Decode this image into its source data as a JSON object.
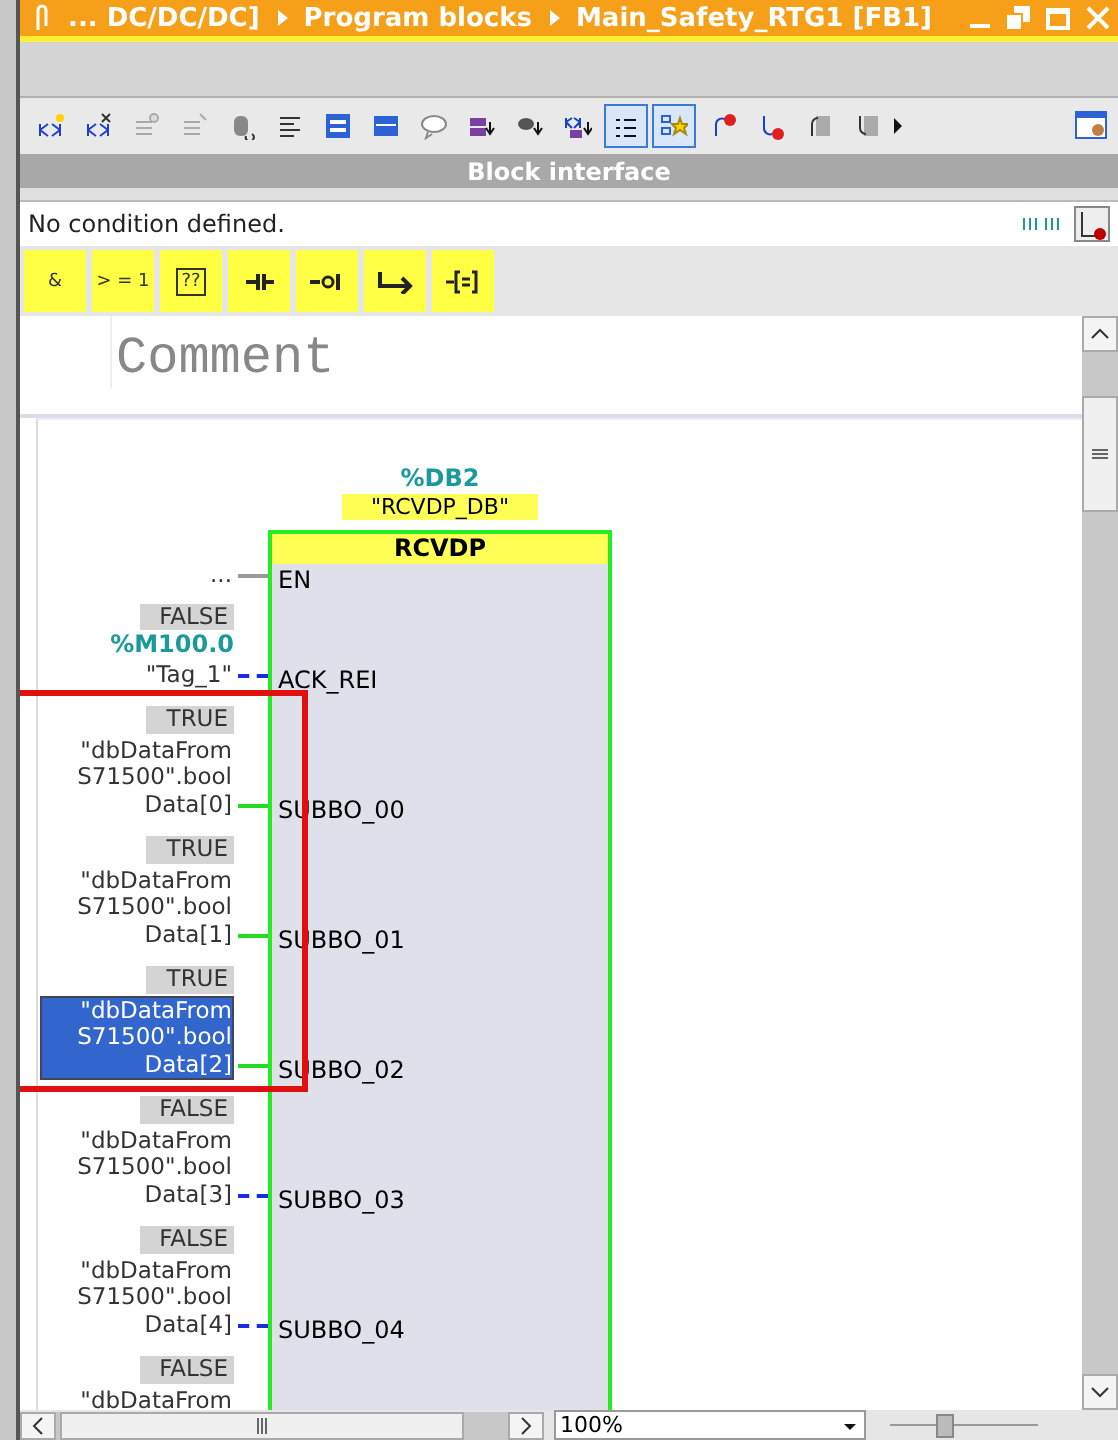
{
  "title_bar": {
    "path": [
      {
        "label": "... DC/DC/DC]"
      },
      {
        "label": "Program blocks"
      },
      {
        "label": "Main_Safety_RTG1 [FB1]"
      }
    ]
  },
  "toolbar": {
    "buttons": [
      {
        "pressed": false
      },
      {
        "pressed": false
      },
      {
        "pressed": false
      },
      {
        "pressed": false
      },
      {
        "pressed": false
      },
      {
        "pressed": false
      },
      {
        "pressed": false
      },
      {
        "pressed": false
      },
      {
        "pressed": false
      },
      {
        "pressed": false
      },
      {
        "pressed": false
      },
      {
        "pressed": false
      },
      {
        "pressed": true
      },
      {
        "pressed": true
      },
      {
        "pressed": false
      },
      {
        "pressed": false
      },
      {
        "pressed": false
      },
      {
        "pressed": false
      }
    ]
  },
  "block_interface": {
    "label": "Block interface"
  },
  "condition": {
    "text": "No condition defined."
  },
  "instructions": [
    {
      "kind": "text",
      "label": "&"
    },
    {
      "kind": "text",
      "label": "> = 1"
    },
    {
      "kind": "box",
      "label": "??"
    },
    {
      "kind": "contact"
    },
    {
      "kind": "negated-contact"
    },
    {
      "kind": "branch"
    },
    {
      "kind": "box-coil"
    }
  ],
  "network": {
    "comment": "Comment",
    "instance_address": "%DB2",
    "instance_name": "\"RCVDP_DB\"",
    "block_name": "RCVDP",
    "pins": [
      {
        "name": "EN",
        "operand": [
          "..."
        ],
        "selected": false
      },
      {
        "name": "ACK_REI",
        "status": "FALSE",
        "address": "%M100.0",
        "operand": [
          "\"Tag_1\""
        ],
        "signal": false,
        "selected": false
      },
      {
        "name": "SUBBO_00",
        "status": "TRUE",
        "operand": [
          "\"dbDataFrom",
          "S71500\".bool",
          "Data[0]"
        ],
        "signal": true,
        "selected": false
      },
      {
        "name": "SUBBO_01",
        "status": "TRUE",
        "operand": [
          "\"dbDataFrom",
          "S71500\".bool",
          "Data[1]"
        ],
        "signal": true,
        "selected": false
      },
      {
        "name": "SUBBO_02",
        "status": "TRUE",
        "operand": [
          "\"dbDataFrom",
          "S71500\".bool",
          "Data[2]"
        ],
        "signal": true,
        "selected": true
      },
      {
        "name": "SUBBO_03",
        "status": "FALSE",
        "operand": [
          "\"dbDataFrom",
          "S71500\".bool",
          "Data[3]"
        ],
        "signal": false,
        "selected": false
      },
      {
        "name": "SUBBO_04",
        "status": "FALSE",
        "operand": [
          "\"dbDataFrom",
          "S71500\".bool",
          "Data[4]"
        ],
        "signal": false,
        "selected": false
      },
      {
        "status": "FALSE",
        "operand": [
          "\"dbDataFrom"
        ],
        "selected": false
      }
    ],
    "annotation_frame": true
  },
  "zoom": {
    "value": "100%",
    "level": 0.37
  }
}
